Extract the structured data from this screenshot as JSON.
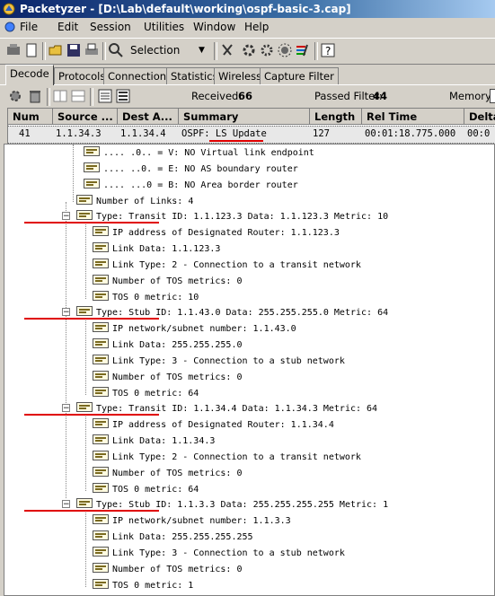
{
  "window": {
    "title": "Packetyzer - [D:\\Lab\\default\\working\\ospf-basic-3.cap]"
  },
  "menu": [
    "File",
    "Edit",
    "Session",
    "Utilities",
    "Window",
    "Help"
  ],
  "toolbar": {
    "selection_label": "Selection"
  },
  "tabs": [
    "Decode",
    "Protocols",
    "Connections",
    "Statistics",
    "Wireless",
    "Capture Filter"
  ],
  "infobar": {
    "received_label": "Received:",
    "received_value": "66",
    "passed_label": "Passed Filter:",
    "passed_value": "44",
    "memory_label": "Memory:"
  },
  "grid": {
    "headers": [
      "Num",
      "Source ...",
      "Dest A...",
      "Summary",
      "Length",
      "Rel Time",
      "Delta"
    ],
    "row": [
      "41",
      "1.1.34.3",
      "1.1.34.4",
      "OSPF: LS Update",
      "127",
      "00:01:18.775.000",
      "00:0"
    ]
  },
  "tree": [
    ".... .0.. = V: NO Virtual link endpoint",
    ".... ..0. = E: NO AS boundary router",
    ".... ...0 = B: NO Area border router",
    "Number of Links: 4",
    "Type: Transit  ID: 1.1.123.3      Data: 1.1.123.3       Metric: 10",
    "IP address of Designated Router: 1.1.123.3",
    "Link Data: 1.1.123.3",
    "Link Type: 2 - Connection to a transit network",
    "Number of TOS metrics: 0",
    "TOS 0 metric: 10",
    "Type: Stub    ID: 1.1.43.0       Data: 255.255.255.0  Metric: 64",
    "IP network/subnet number: 1.1.43.0",
    "Link Data: 255.255.255.0",
    "Link Type: 3 - Connection to a stub network",
    "Number of TOS metrics: 0",
    "TOS 0 metric: 64",
    "Type: Transit  ID: 1.1.34.4       Data: 1.1.34.3        Metric: 64",
    "IP address of Designated Router: 1.1.34.4",
    "Link Data: 1.1.34.3",
    "Link Type: 2 - Connection to a transit network",
    "Number of TOS metrics: 0",
    "TOS 0 metric: 64",
    "Type: Stub    ID: 1.1.3.3        Data: 255.255.255.255 Metric: 1",
    "IP network/subnet number: 1.1.3.3",
    "Link Data: 255.255.255.255",
    "Link Type: 3 - Connection to a stub network",
    "Number of TOS metrics: 0",
    "TOS 0 metric: 1"
  ],
  "colors": {
    "title_bar": "#0a246a",
    "annotation_underline": "#e00000",
    "window_face": "#d4d0c8"
  }
}
